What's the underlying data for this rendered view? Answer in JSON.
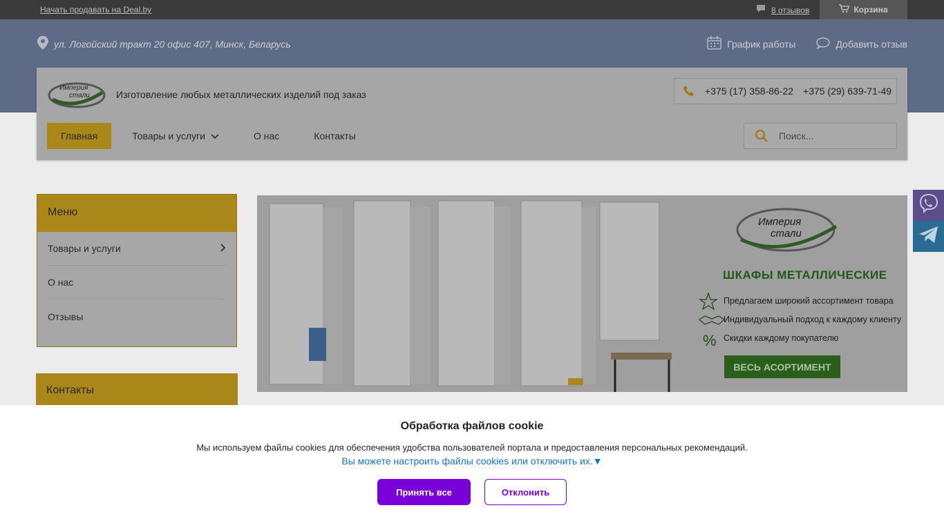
{
  "topbar": {
    "sell_link": "Начать продавать на Deal.by",
    "reviews": "8 отзывов",
    "cart": "Корзина"
  },
  "header": {
    "address": "ул. Логойский тракт 20 офис 407, Минск, Беларусь",
    "schedule": "График работы",
    "add_review": "Добавить отзыв",
    "tagline": "Изготовление любых металлических изделий под заказ",
    "phone1": "+375 (17) 358-86-22",
    "phone2": "+375 (29) 639-71-49",
    "logo_text_1": "Империя",
    "logo_text_2": "стали"
  },
  "nav": {
    "items": [
      "Главная",
      "Товары и услуги",
      "О нас",
      "Контакты"
    ],
    "search_placeholder": "Поиск..."
  },
  "sidebar": {
    "menu_title": "Меню",
    "menu_items": [
      "Товары и услуги",
      "О нас",
      "Отзывы"
    ],
    "contacts_title": "Контакты"
  },
  "banner": {
    "brand_1": "Империя",
    "brand_2": "стали",
    "title": "ШКАФЫ МЕТАЛЛИЧЕСКИЕ",
    "features": [
      "Предлагаем широкий ассортимент товара",
      "Индивидуальный подход к каждому клиенту",
      "Скидки каждому покупателю"
    ],
    "cta": "ВЕСЬ АСОРТИМЕНТ"
  },
  "cookie": {
    "title": "Обработка файлов cookie",
    "text": "Мы используем файлы cookies для обеспечения удобства пользователей портала и предоставления персональных рекомендаций.",
    "link": "Вы можете настроить файлы cookies или отключить их.▼",
    "accept": "Принять все",
    "decline": "Отклонить"
  },
  "icons": {
    "address": "map-pin-icon",
    "schedule": "calendar-icon",
    "review": "speech-bubble-icon",
    "cart": "cart-icon",
    "phone": "phone-icon",
    "search": "search-icon",
    "viber": "viber-icon",
    "telegram": "telegram-icon"
  },
  "colors": {
    "accent": "#a98719",
    "cookie_button": "#7a00d9",
    "cookie_link": "#1773c6"
  }
}
